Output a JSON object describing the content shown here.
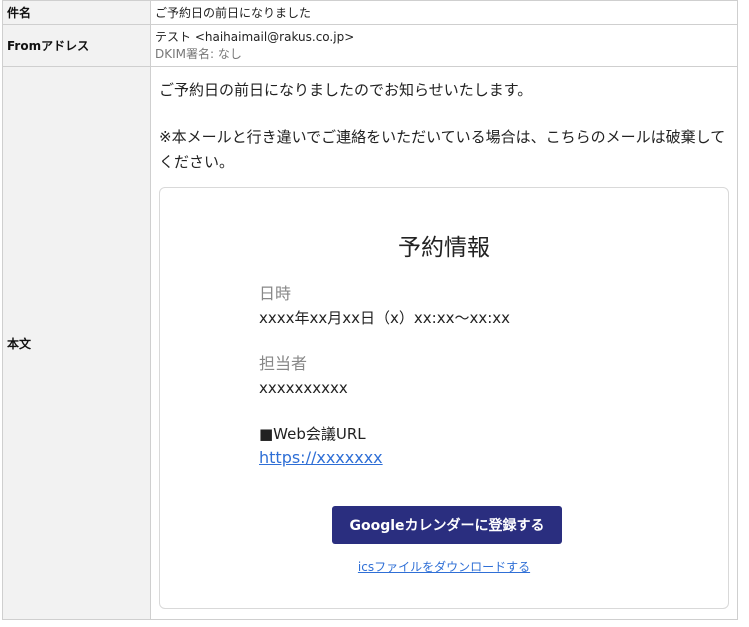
{
  "header": {
    "subject_label": "件名",
    "subject_value": "ご予約日の前日になりました",
    "from_label": "Fromアドレス",
    "from_value": "テスト <haihaimail@rakus.co.jp>",
    "dkim_value": "DKIM署名: なし",
    "body_label": "本文"
  },
  "body": {
    "paragraph1": "ご予約日の前日になりましたのでお知らせいたします。",
    "paragraph2": "※本メールと行き違いでご連絡をいただいている場合は、こちらのメールは破棄してください。"
  },
  "card": {
    "title": "予約情報",
    "datetime_label": "日時",
    "datetime_value": "xxxx年xx月xx日（x）xx:xx〜xx:xx",
    "staff_label": "担当者",
    "staff_value": "xxxxxxxxxx",
    "web_title": "■Web会議URL",
    "web_url": "https://xxxxxxx",
    "gcal_button": "Googleカレンダーに登録する",
    "ics_link": "icsファイルをダウンロードする"
  },
  "colors": {
    "button_bg": "#2a2e7f",
    "link": "#2f6fd6",
    "label_bg": "#f2f2f2"
  }
}
